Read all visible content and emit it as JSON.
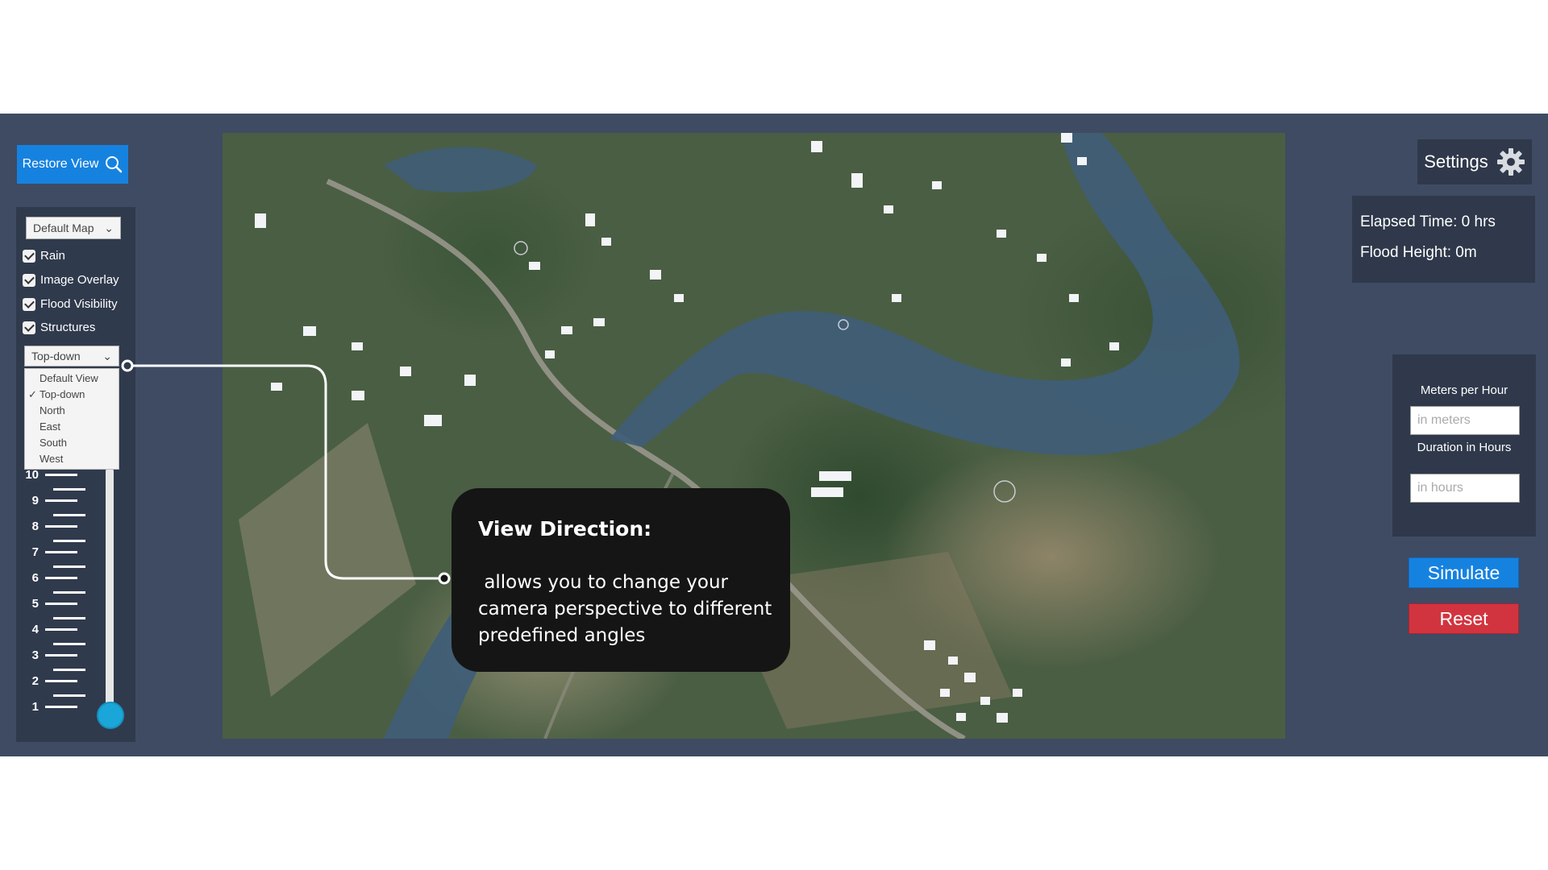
{
  "toolbar": {
    "restore_label": "Restore View",
    "restore_icon": "search-icon"
  },
  "layers": {
    "map_type": "Default Map",
    "toggles": [
      {
        "label": "Rain",
        "checked": true
      },
      {
        "label": "Image Overlay",
        "checked": true
      },
      {
        "label": "Flood Visibility",
        "checked": true
      },
      {
        "label": "Structures",
        "checked": true
      }
    ]
  },
  "view_direction": {
    "selected": "Top-down",
    "options": [
      "Default View",
      "Top-down",
      "North",
      "East",
      "South",
      "West"
    ]
  },
  "flood_scale": {
    "ticks": [
      "10",
      "9",
      "8",
      "7",
      "6",
      "5",
      "4",
      "3",
      "2",
      "1"
    ],
    "slider_value": 1
  },
  "settings": {
    "label": "Settings",
    "icon": "gear-icon"
  },
  "stats": {
    "elapsed": "Elapsed Time: 0 hrs",
    "flood_height": "Flood Height: 0m"
  },
  "simulation": {
    "meters_label": "Meters per Hour",
    "meters_placeholder": "in meters",
    "duration_label": "Duration in Hours",
    "duration_placeholder": "in hours",
    "simulate_label": "Simulate",
    "reset_label": "Reset"
  },
  "tooltip": {
    "title": "View Direction:",
    "body": " allows you to change your camera perspective to different predefined angles"
  },
  "colors": {
    "accent": "#1682e0",
    "danger": "#d2343f",
    "panel": "#2f394b",
    "slider": "#1aa6d8"
  }
}
